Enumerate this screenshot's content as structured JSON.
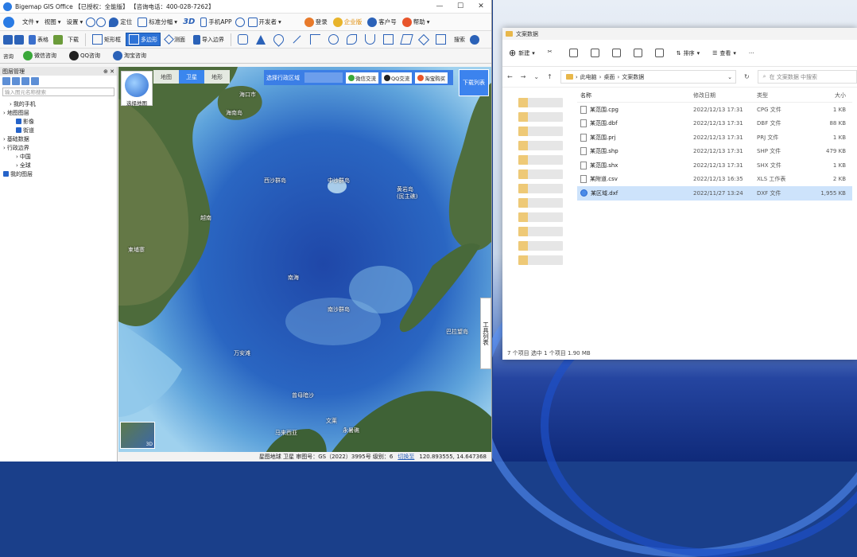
{
  "gis": {
    "title": "Bigemap GIS Office 【已授权：全能版】 【咨询电话：400-028-7262】",
    "menu": [
      "文件",
      "视图",
      "设置",
      "定位",
      "标准分幅",
      "3D",
      "手机APP",
      "开发者"
    ],
    "menu_right": [
      "登录",
      "企业版",
      "客户号",
      "帮助"
    ],
    "toolbar": {
      "table": "表格",
      "download": "下载",
      "rect": "矩形框",
      "polygon": "多边形",
      "measure": "测面",
      "import": "导入边界",
      "search": "搜索"
    },
    "toolbar3": [
      "微信咨询",
      "QQ咨询",
      "淘宝咨询"
    ],
    "toolbar3_prefix": "咨询"
  },
  "sidebar": {
    "header": "图层管理",
    "search_placeholder": "输入图元名称搜索",
    "tree": [
      {
        "label": "我的手机",
        "indent": 1,
        "check": false
      },
      {
        "label": "地图图层",
        "indent": 0,
        "check": false
      },
      {
        "label": "影像",
        "indent": 2,
        "check": true
      },
      {
        "label": "街道",
        "indent": 2,
        "check": true
      },
      {
        "label": "基础数据",
        "indent": 0,
        "check": false
      },
      {
        "label": "行政边界",
        "indent": 0,
        "check": false
      },
      {
        "label": "中国",
        "indent": 2,
        "check": false
      },
      {
        "label": "全球",
        "indent": 2,
        "check": false
      },
      {
        "label": "我的图层",
        "indent": 0,
        "check": true
      }
    ]
  },
  "map": {
    "tabs": [
      "地图",
      "卫星",
      "地形"
    ],
    "active_tab": "卫星",
    "region_label": "选择行政区域",
    "buttons": [
      "微信交流",
      "QQ交流",
      "淘宝购买"
    ],
    "download_list": "下载列表",
    "select_map": "选择地图",
    "tool_list": "工具列表",
    "thumb_label": "3D",
    "labels": [
      "海口市",
      "海南岛",
      "西沙群岛",
      "中沙群岛",
      "黄岩岛(民主礁)",
      "越南",
      "柬埔寨",
      "南海",
      "南沙群岛",
      "万安滩",
      "曾母暗沙",
      "文莱",
      "巴拉望岛",
      "马来西亚",
      "永暑礁"
    ],
    "status_text": "星图地球 卫星 审图号：GS（2022）3995号  级别：6",
    "status_link": "切换至",
    "coords": "120.893555, 14.647368"
  },
  "explorer": {
    "title": "文案数据",
    "new_label": "新建",
    "sort_label": "排序",
    "view_label": "查看",
    "more_label": "···",
    "breadcrumb": [
      "此电脑",
      "桌面",
      "文案数据"
    ],
    "search_placeholder": "在 文案数据 中搜索",
    "columns": [
      "名称",
      "修改日期",
      "类型",
      "大小"
    ],
    "files": [
      {
        "name": "某范围.cpg",
        "date": "2022/12/13 17:31",
        "type": "CPG 文件",
        "size": "1 KB"
      },
      {
        "name": "某范围.dbf",
        "date": "2022/12/13 17:31",
        "type": "DBF 文件",
        "size": "88 KB"
      },
      {
        "name": "某范围.prj",
        "date": "2022/12/13 17:31",
        "type": "PRJ 文件",
        "size": "1 KB"
      },
      {
        "name": "某范围.shp",
        "date": "2022/12/13 17:31",
        "type": "SHP 文件",
        "size": "479 KB"
      },
      {
        "name": "某范围.shx",
        "date": "2022/12/13 17:31",
        "type": "SHX 文件",
        "size": "1 KB"
      },
      {
        "name": "某附道.csv",
        "date": "2022/12/13 16:35",
        "type": "XLS 工作表",
        "size": "2 KB"
      },
      {
        "name": "某区域.dxf",
        "date": "2022/11/27 13:24",
        "type": "DXF 文件",
        "size": "1,955 KB"
      }
    ],
    "status": "7 个项目    选中 1 个项目  1.90 MB"
  }
}
